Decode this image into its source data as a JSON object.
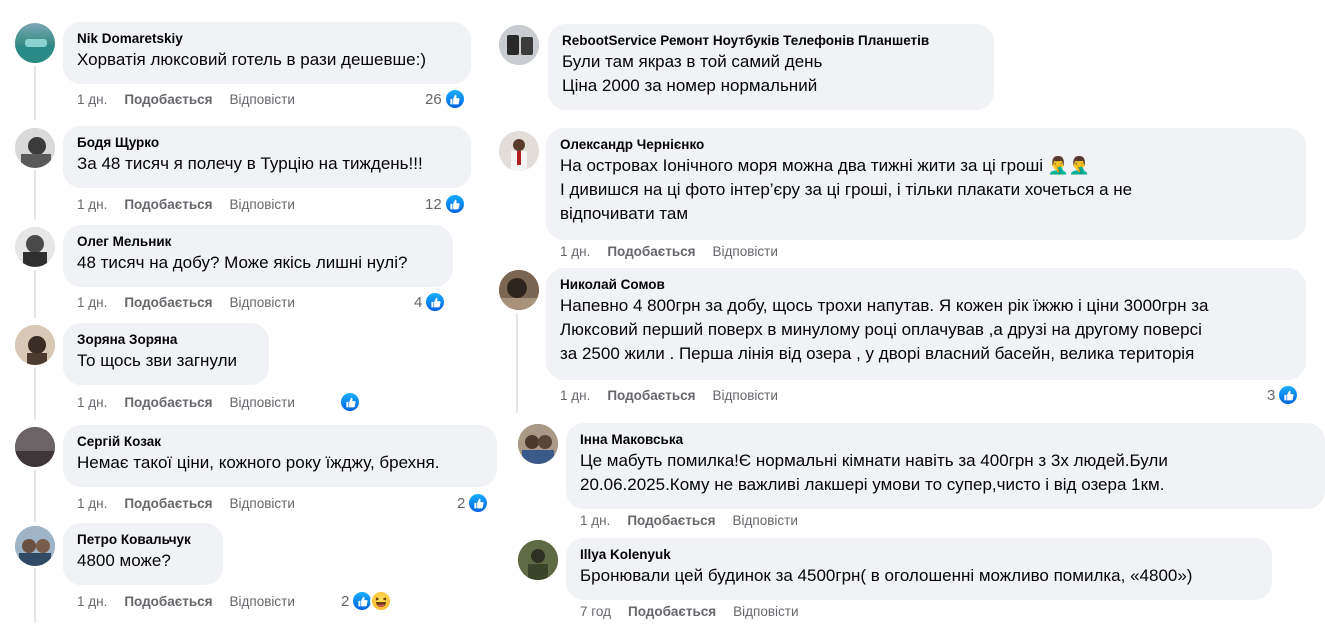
{
  "labels": {
    "like": "Подобається",
    "reply": "Відповісти"
  },
  "colors": {
    "bubble": "#f0f2f5",
    "meta": "#65676b",
    "like_blue": "#0866ff"
  },
  "left_column": [
    {
      "author": "Nik Domaretskiy",
      "lines": [
        "Хорватія люксовий готель в рази дешевше:)"
      ],
      "time": "1 дн.",
      "reaction_count": "26",
      "reactions": [
        "like-icon"
      ]
    },
    {
      "author": "Бодя Щурко",
      "lines": [
        "За 48 тисяч я полечу в Турцію на тиждень!!!"
      ],
      "time": "1 дн.",
      "reaction_count": "12",
      "reactions": [
        "like-icon"
      ]
    },
    {
      "author": "Олег Мельник",
      "lines": [
        "48 тисяч на добу? Може якісь лишні нулі?"
      ],
      "time": "1 дн.",
      "reaction_count": "4",
      "reactions": [
        "like-icon"
      ]
    },
    {
      "author": "Зоряна Зоряна",
      "lines": [
        "То щось зви загнули"
      ],
      "time": "1 дн.",
      "reaction_count": "",
      "reactions": [
        "like-icon"
      ]
    },
    {
      "author": "Сергій Козак",
      "lines": [
        "Немає такої ціни, кожного року їжджу, брехня."
      ],
      "time": "1 дн.",
      "reaction_count": "2",
      "reactions": [
        "like-icon"
      ]
    },
    {
      "author": "Петро Ковальчук",
      "lines": [
        "4800 може?"
      ],
      "time": "1 дн.",
      "reaction_count": "2",
      "reactions": [
        "like-icon",
        "haha-icon"
      ]
    }
  ],
  "right_column": [
    {
      "author": "RebootService Ремонт Ноутбуків Телефонів Планшетів",
      "lines": [
        "Були там якраз в той самий день",
        "Ціна 2000 за номер нормальний"
      ],
      "time": "",
      "reaction_count": "",
      "reactions": []
    },
    {
      "author": "Олександр Чернієнко",
      "lines": [
        "На островах Іонічного моря можна два тижні жити за ці гроші",
        "І дивишся на ці фото інтер’єру за ці гроші, і тільки плакати хочеться а не",
        "відпочивати там"
      ],
      "emoji": "🤦‍♂️🤦‍♂️",
      "time": "1 дн.",
      "reaction_count": "",
      "reactions": []
    },
    {
      "author": "Николай Сомов",
      "lines": [
        "Напевно 4 800грн за добу, щось трохи напутав. Я кожен рік їжжю і ціни 3000грн за",
        "Люксовий перший поверх в минулому році оплачував ,а друзі на другому поверсі",
        "за 2500 жили . Перша лінія від озера , у дворі власний басейн, велика територія"
      ],
      "time": "1 дн.",
      "reaction_count": "3",
      "reactions": [
        "like-icon"
      ]
    },
    {
      "author": "Інна Маковська",
      "lines": [
        "Це мабуть помилка!Є нормальні кімнати навіть за 400грн з 3х людей.Були",
        "20.06.2025.Кому не важливі лакшері умови то супер,чисто і від озера 1км."
      ],
      "time": "1 дн.",
      "reaction_count": "",
      "reactions": []
    },
    {
      "author": "Illya Kolenyuk",
      "lines": [
        "Бронювали цей будинок за 4500грн( в оголошенні можливо помилка, «4800»)"
      ],
      "time": "7 год",
      "reaction_count": "",
      "reactions": []
    }
  ]
}
